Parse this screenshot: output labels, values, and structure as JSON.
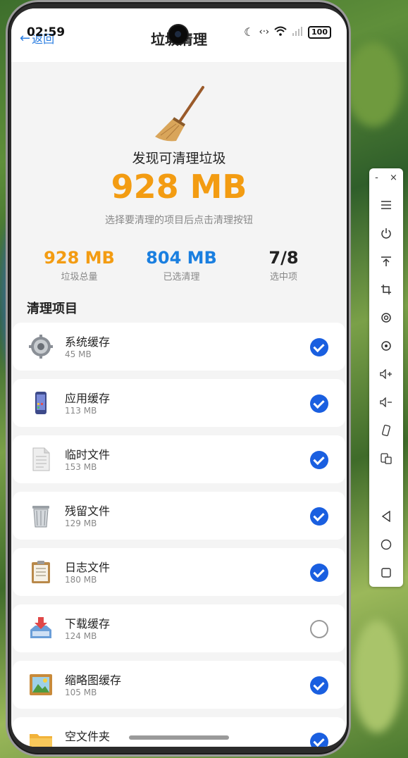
{
  "status_bar": {
    "time": "02:59",
    "battery": "100"
  },
  "header": {
    "back_label": "返回",
    "title": "垃圾清理"
  },
  "hero": {
    "heading": "发现可清理垃圾",
    "size": "928 MB",
    "hint": "选择要清理的项目后点击清理按钮"
  },
  "stats": [
    {
      "value": "928 MB",
      "label": "垃圾总量",
      "color": "#f39c12"
    },
    {
      "value": "804 MB",
      "label": "已选清理",
      "color": "#1a7fe0"
    },
    {
      "value": "7/8",
      "label": "选中项",
      "color": "#222222"
    }
  ],
  "section_title": "清理项目",
  "items": [
    {
      "name": "系统缓存",
      "size": "45 MB",
      "icon": "gear-icon",
      "checked": true
    },
    {
      "name": "应用缓存",
      "size": "113 MB",
      "icon": "phone-icon",
      "checked": true
    },
    {
      "name": "临时文件",
      "size": "153 MB",
      "icon": "document-icon",
      "checked": true
    },
    {
      "name": "残留文件",
      "size": "129 MB",
      "icon": "trash-icon",
      "checked": true
    },
    {
      "name": "日志文件",
      "size": "180 MB",
      "icon": "clipboard-icon",
      "checked": true
    },
    {
      "name": "下载缓存",
      "size": "124 MB",
      "icon": "download-tray-icon",
      "checked": false
    },
    {
      "name": "缩略图缓存",
      "size": "105 MB",
      "icon": "picture-icon",
      "checked": true
    },
    {
      "name": "空文件夹",
      "size": "",
      "icon": "folder-icon",
      "checked": true
    }
  ],
  "toolbar": {
    "minimize": "-",
    "close": "×",
    "buttons": [
      "menu-icon",
      "power-icon",
      "pin-top-icon",
      "crop-icon",
      "rotate-icon",
      "record-icon",
      "volume-up-icon",
      "volume-down-icon",
      "shake-icon",
      "copy-screen-icon",
      "back-nav-icon",
      "home-nav-icon",
      "recents-nav-icon"
    ]
  }
}
